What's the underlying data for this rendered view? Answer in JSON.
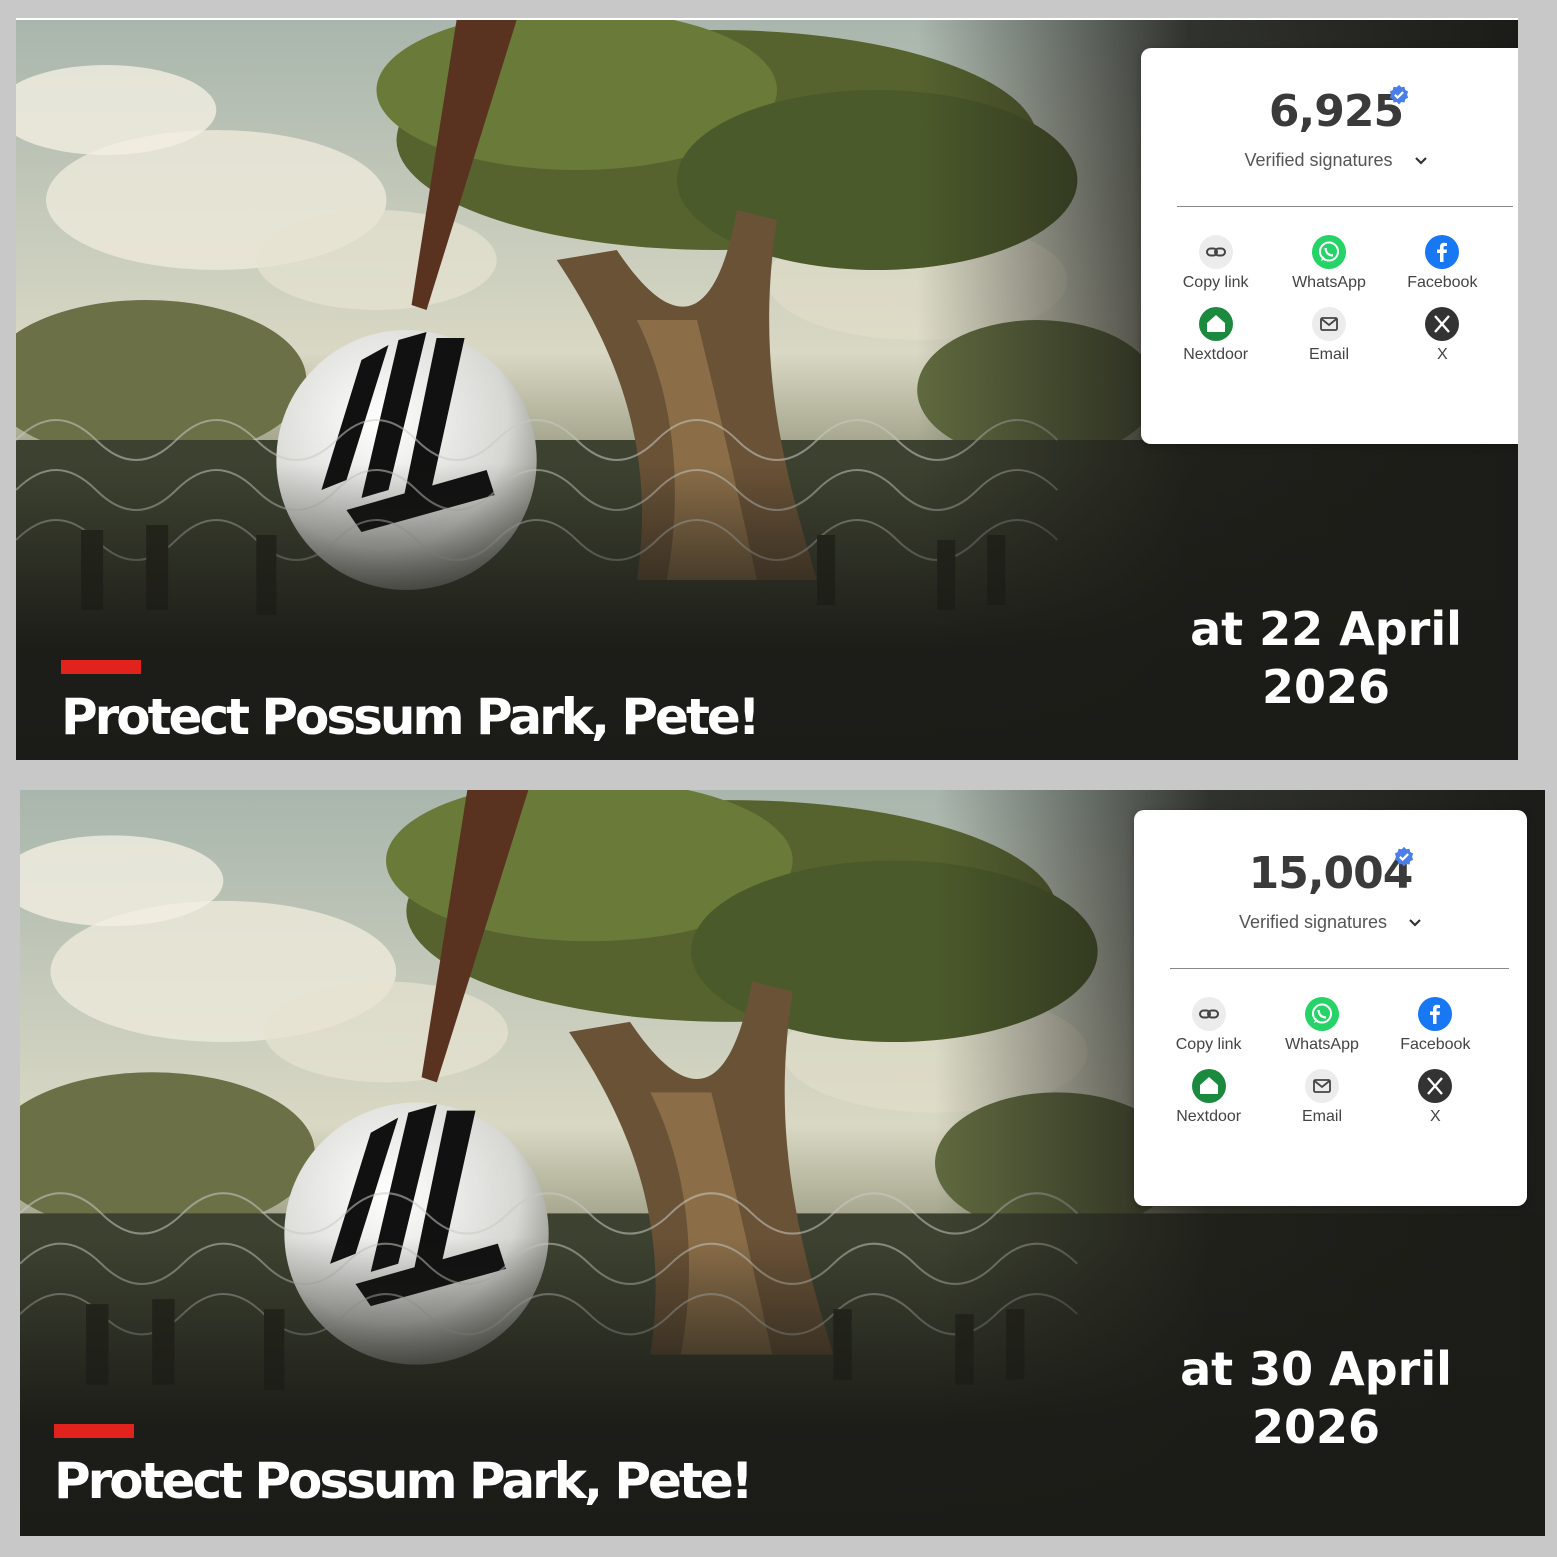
{
  "panels": [
    {
      "count": "6,925",
      "signatures_label": "Verified signatures",
      "share": [
        "Copy link",
        "WhatsApp",
        "Facebook",
        "Nextdoor",
        "Email",
        "X"
      ],
      "title": "Protect Possum Park, Pete!",
      "date_line1": "at 22 April",
      "date_line2": "2026"
    },
    {
      "count": "15,004",
      "signatures_label": "Verified signatures",
      "share": [
        "Copy link",
        "WhatsApp",
        "Facebook",
        "Nextdoor",
        "Email",
        "X"
      ],
      "title": "Protect Possum Park, Pete!",
      "date_line1": "at 30 April",
      "date_line2": "2026"
    }
  ],
  "icons": {
    "verified": "verified-badge-icon",
    "chevron": "chevron-down-icon",
    "copy_link": "link-icon",
    "whatsapp": "whatsapp-icon",
    "facebook": "facebook-icon",
    "nextdoor": "nextdoor-icon",
    "email": "email-icon",
    "x": "x-icon"
  },
  "colors": {
    "accent_red": "#e2221d",
    "verified_blue": "#4a7ee8",
    "whatsapp": "#25d366",
    "facebook": "#1877f2",
    "nextdoor": "#1b8a3e"
  }
}
